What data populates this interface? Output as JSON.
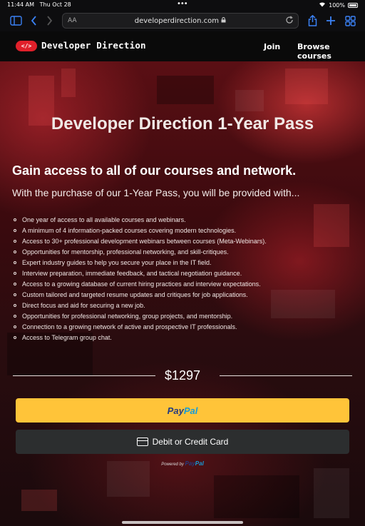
{
  "status_bar": {
    "time": "11:44 AM",
    "date": "Thu Oct 28",
    "battery": "100%"
  },
  "browser": {
    "text_size_label": "AA",
    "url": "developerdirection.com"
  },
  "site": {
    "logo_text": "</>",
    "brand": "Developer Direction",
    "nav": {
      "join": "Join",
      "browse": "Browse courses"
    }
  },
  "hero": {
    "title": "Developer Direction 1-Year Pass",
    "subtitle": "Gain access to all of our courses and network.",
    "lead": "With the purchase of our 1-Year Pass, you will be provided with...",
    "features": [
      "One year of access to all available courses and webinars.",
      "A minimum of 4 information-packed courses covering modern technologies.",
      "Access to 30+ professional development webinars between courses (Meta-Webinars).",
      "Opportunities for mentorship, professional networking, and skill-critiques.",
      "Expert industry guides to help you secure your place in the IT field.",
      "Interview preparation, immediate feedback, and tactical negotiation guidance.",
      "Access to a growing database of current hiring practices and interview expectations.",
      "Custom tailored and targeted resume updates and critiques for job applications.",
      "Direct focus and aid for securing a new job.",
      "Opportunities for professional networking, group projects, and mentorship.",
      "Connection to a growing network of active and prospective IT professionals.",
      "Access to Telegram group chat."
    ]
  },
  "checkout": {
    "price": "$1297",
    "paypal_label_1": "Pay",
    "paypal_label_2": "Pal",
    "card_label": "Debit or Credit Card",
    "powered_by": "Powered by",
    "powered_brand_1": "Pay",
    "powered_brand_2": "Pal"
  },
  "colors": {
    "accent_red": "#e0202a",
    "paypal_yellow": "#ffc439",
    "card_button": "#2c2e2f",
    "browser_blue": "#3b82f6"
  }
}
